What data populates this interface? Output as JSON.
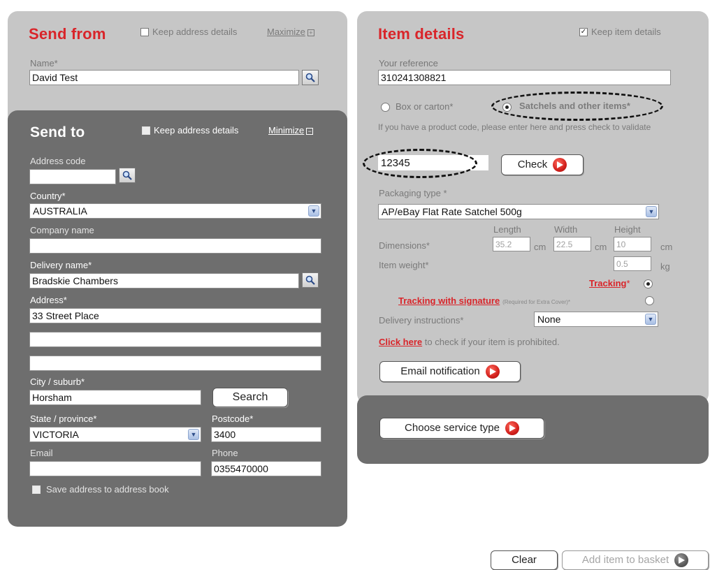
{
  "send_from": {
    "title": "Send from",
    "keep_label": "Keep address details",
    "maximize_label": "Maximize",
    "maximize_icon": "+",
    "name_label": "Name*",
    "name_value": "David Test"
  },
  "send_to": {
    "title": "Send to",
    "keep_label": "Keep address details",
    "minimize_label": "Minimize",
    "minimize_icon": "−",
    "address_code_label": "Address code",
    "country_label": "Country*",
    "country_value": "AUSTRALIA",
    "company_label": "Company name",
    "delivery_name_label": "Delivery name*",
    "delivery_name_value": "Bradskie Chambers",
    "address_label": "Address*",
    "address_line1": "33  Street Place",
    "city_label": "City / suburb*",
    "city_value": "Horsham",
    "search_button": "Search",
    "state_label": "State / province*",
    "state_value": "VICTORIA",
    "postcode_label": "Postcode*",
    "postcode_value": "3400",
    "email_label": "Email",
    "phone_label": "Phone",
    "phone_value": "0355470000",
    "save_label": "Save address to address book"
  },
  "item": {
    "title": "Item details",
    "keep_label": "Keep item details",
    "reference_label": "Your reference",
    "reference_value": "310241308821",
    "box_label": "Box or carton*",
    "satchel_label": "Satchels and other items*",
    "product_code_hint": "If you have a product code, please enter here and press check to validate",
    "product_code_value": "12345",
    "check_button": "Check",
    "packaging_label": "Packaging type *",
    "packaging_value": "AP/eBay Flat Rate Satchel 500g",
    "length_label": "Length",
    "width_label": "Width",
    "height_label": "Height",
    "dimensions_label": "Dimensions*",
    "length_value": "35.2",
    "width_value": "22.5",
    "height_value": "10",
    "unit_cm": "cm",
    "weight_label": "Item weight*",
    "weight_value": "0.5",
    "unit_kg": "kg",
    "tracking_label": "Tracking",
    "tracking_req": "*",
    "tracking_sig_label": "Tracking with signature",
    "tracking_sig_note": "(Required for Extra Cover)*",
    "delivery_instr_label": "Delivery instructions*",
    "delivery_instr_value": "None",
    "click_here": "Click here",
    "prohibited_text": " to check if your item is prohibited.",
    "email_notification_button": "Email notification",
    "choose_service_button": "Choose service type"
  },
  "footer": {
    "clear_button": "Clear",
    "add_basket_button": "Add item to basket"
  },
  "colors": {
    "accent_red": "#d9252a",
    "panel_light": "#c6c6c6",
    "panel_dark": "#6e6e6e"
  }
}
